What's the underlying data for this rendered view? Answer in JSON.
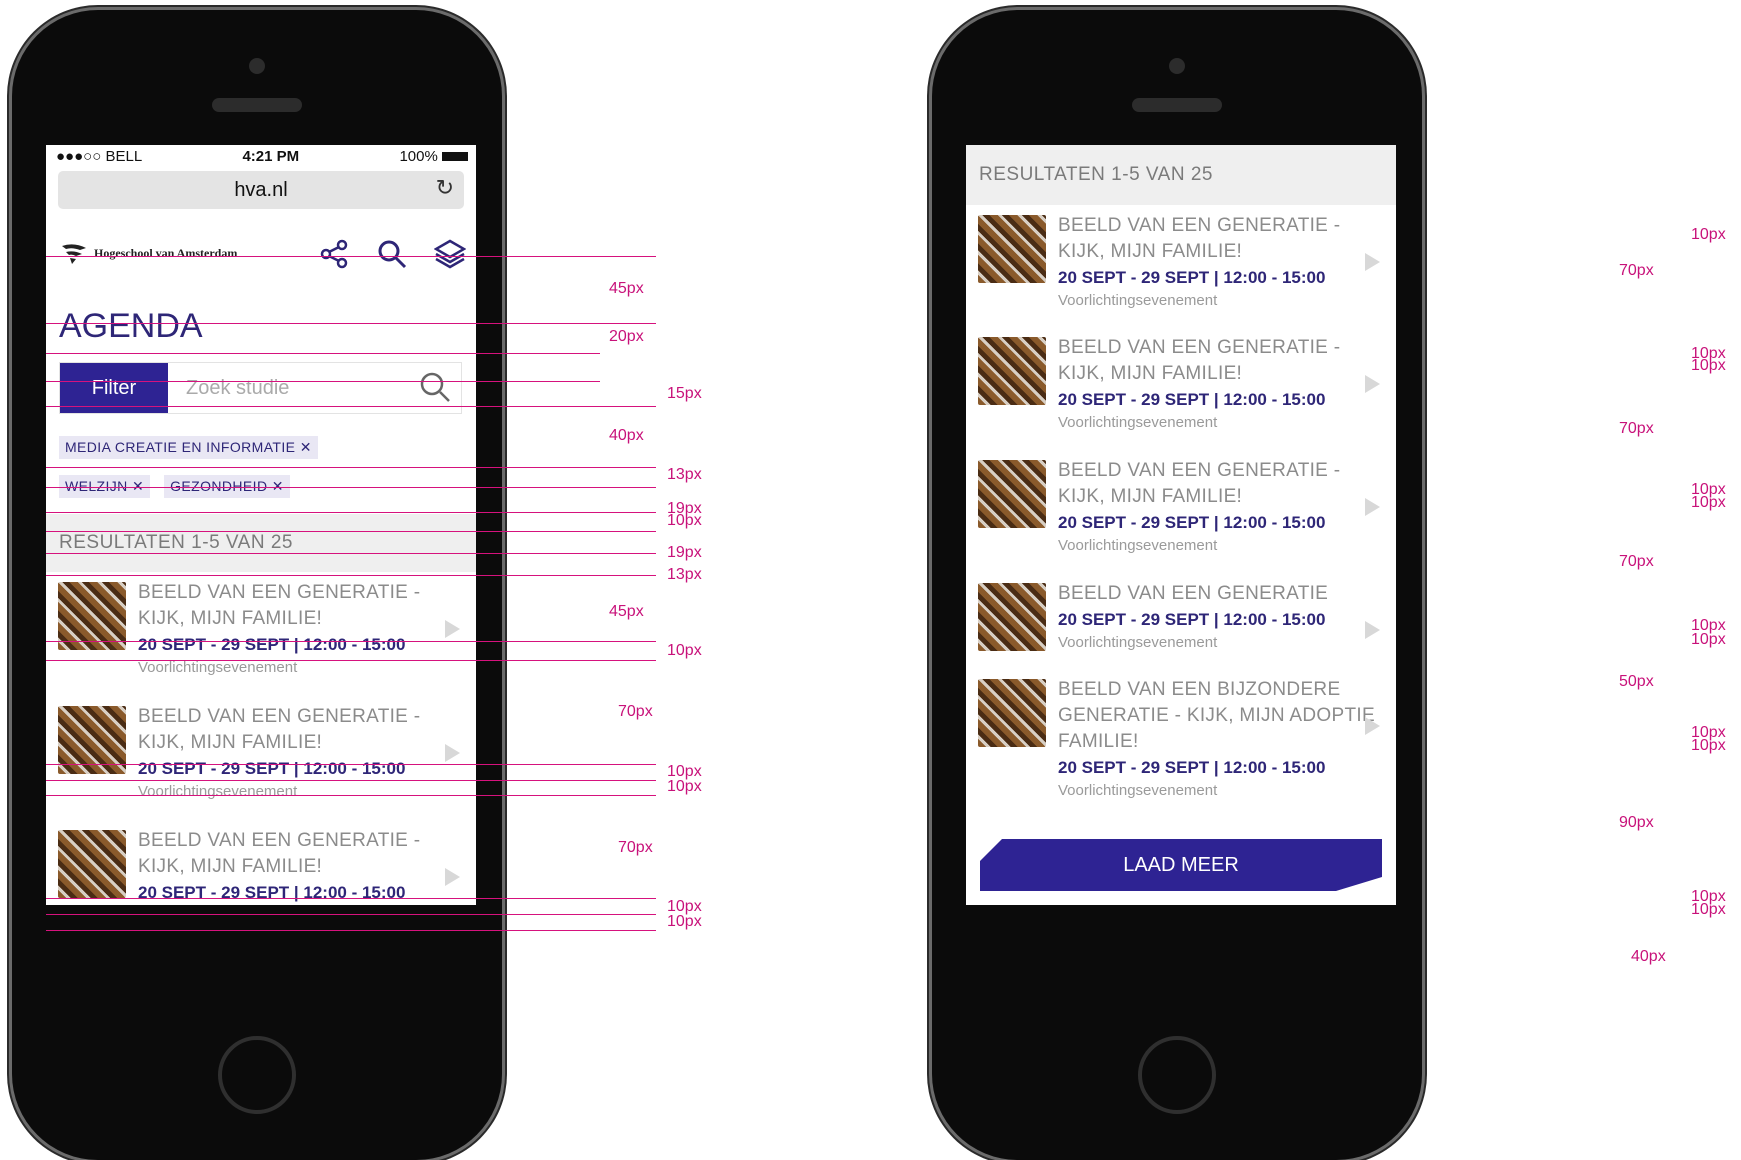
{
  "colors": {
    "brand": "#2e2393",
    "guide": "#d6127d"
  },
  "status": {
    "carrier": "●●●○○ BELL",
    "time": "4:21 PM",
    "battery": "100%"
  },
  "browser": {
    "url": "hva.nl"
  },
  "header": {
    "logo": "Hogeschool van Amsterdam",
    "icons": [
      "share-icon",
      "search-icon",
      "layers-icon"
    ]
  },
  "page": {
    "title": "AGENDA"
  },
  "filter": {
    "button": "Filter",
    "placeholder": "Zoek studie"
  },
  "tags": [
    "MEDIA CREATIE EN INFORMATIE ✕",
    "WELZIJN ✕",
    "GEZONDHEID ✕"
  ],
  "results_label": "RESULTATEN 1-5 VAN 25",
  "items": [
    {
      "title": "BEELD VAN EEN GENERATIE - KIJK, MIJN FAMILIE!",
      "date": "20 SEPT - 29 SEPT | 12:00 - 15:00",
      "type": "Voorlichtingsevenement"
    },
    {
      "title": "BEELD VAN EEN GENERATIE - KIJK, MIJN FAMILIE!",
      "date": "20 SEPT - 29 SEPT | 12:00 - 15:00",
      "type": "Voorlichtingsevenement"
    },
    {
      "title": "BEELD VAN EEN GENERATIE - KIJK, MIJN FAMILIE!",
      "date": "20 SEPT - 29 SEPT | 12:00 - 15:00",
      "type": "Voorlichtingsevenement"
    },
    {
      "title": "BEELD VAN EEN GENERATIE",
      "date": "20 SEPT - 29 SEPT | 12:00 - 15:00",
      "type": "Voorlichtingsevenement"
    },
    {
      "title": "BEELD VAN EEN BIJZONDERE GENERATIE - KIJK, MIJN ADOPTIE FAMILIE!",
      "date": "20 SEPT - 29 SEPT | 12:00 - 15:00",
      "type": "Voorlichtingsevenement"
    }
  ],
  "load_more": "LAAD MEER",
  "annotations_left": [
    "45px",
    "20px",
    "15px",
    "40px",
    "13px",
    "19px",
    "10px",
    "19px",
    "13px",
    "45px",
    "10px",
    "70px",
    "10px",
    "10px",
    "70px",
    "10px",
    "10px"
  ],
  "annotations_right": [
    "10px",
    "70px",
    "10px",
    "10px",
    "70px",
    "10px",
    "10px",
    "70px",
    "10px",
    "10px",
    "50px",
    "10px",
    "10px",
    "90px",
    "10px",
    "10px",
    "40px"
  ]
}
